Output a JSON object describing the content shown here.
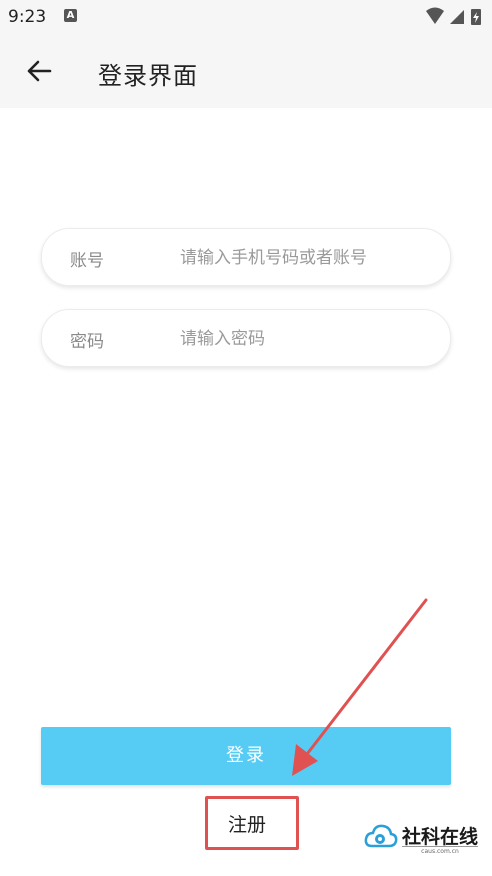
{
  "status_bar": {
    "time": "9:23",
    "notification_icon": "font-a-icon",
    "icons": [
      "wifi-icon",
      "signal-icon",
      "battery-charging-icon"
    ]
  },
  "app_bar": {
    "back_icon": "arrow-left-icon",
    "title": "登录界面"
  },
  "form": {
    "account": {
      "label": "账号",
      "placeholder": "请输入手机号码或者账号",
      "value": ""
    },
    "password": {
      "label": "密码",
      "placeholder": "请输入密码",
      "value": ""
    }
  },
  "actions": {
    "login_label": "登录",
    "register_label": "注册"
  },
  "annotation": {
    "color": "#e05252"
  },
  "watermark": {
    "name": "社科在线",
    "url": "caus.com.cn"
  },
  "colors": {
    "accent": "#56ccf5",
    "background": "#ffffff",
    "app_bar": "#f6f6f6"
  }
}
